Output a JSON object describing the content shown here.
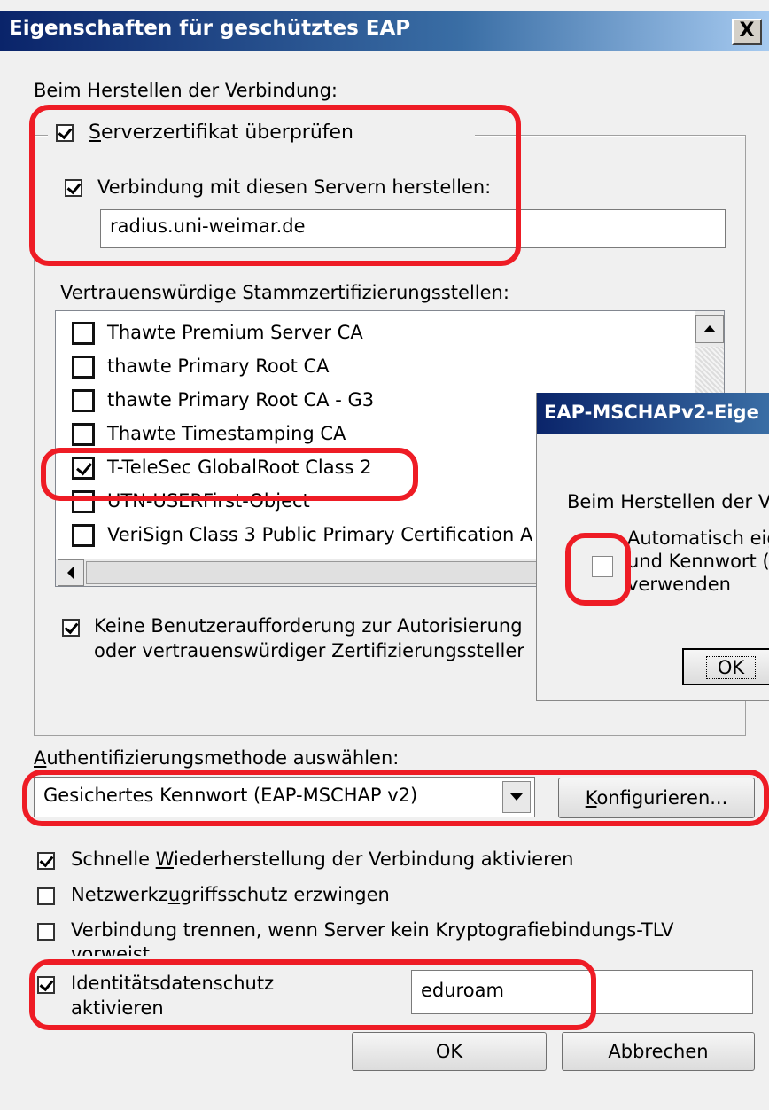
{
  "dialog": {
    "title": "Eigenschaften für geschütztes EAP",
    "close_label": "X",
    "connect_heading": "Beim Herstellen der Verbindung:",
    "verify_cert_label": "Serverzertifikat überprüfen",
    "connect_servers_label": "Verbindung mit diesen Servern herstellen:",
    "server_value": "radius.uni-weimar.de",
    "trusted_ca_label": "Vertrauenswürdige Stammzertifizierungsstellen:",
    "ca_list": [
      {
        "label": "Thawte Premium Server CA",
        "checked": false
      },
      {
        "label": "thawte Primary Root CA",
        "checked": false
      },
      {
        "label": "thawte Primary Root CA - G3",
        "checked": false
      },
      {
        "label": "Thawte Timestamping CA",
        "checked": false
      },
      {
        "label": "T-TeleSec GlobalRoot Class 2",
        "checked": true
      },
      {
        "label": "UTN-USERFirst-Object",
        "checked": false
      },
      {
        "label": "VeriSign Class 3 Public Primary Certification A",
        "checked": false
      }
    ],
    "no_prompt_line1": "Keine Benutzeraufforderung zur Autorisierung",
    "no_prompt_line2": "oder vertrauenswürdiger Zertifizierungssteller",
    "auth_method_label": "Authentifizierungsmethode auswählen:",
    "auth_method_value": "Gesichertes Kennwort (EAP-MSCHAP v2)",
    "configure_button": "Konfigurieren...",
    "fast_reconnect_label": "Schnelle Wiederherstellung der Verbindung aktivieren",
    "nap_label": "Netzwerkzugriffsschutz erzwingen",
    "disconnect_label_line1": "Verbindung trennen, wenn Server kein Kryptografiebindungs-TLV",
    "disconnect_label_line2": "vorweist",
    "identity_privacy_line1": "Identitätsdatenschutz",
    "identity_privacy_line2": "aktivieren",
    "identity_value": "eduroam",
    "ok_button": "OK",
    "cancel_button": "Abbrechen"
  },
  "popup": {
    "title": "EAP-MSCHAPv2-Eige",
    "heading": "Beim Herstellen der V",
    "auto_line1": "Automatisch eig",
    "auto_line2": "und Kennwort (",
    "auto_line3": "verwenden",
    "ok_button": "OK"
  }
}
